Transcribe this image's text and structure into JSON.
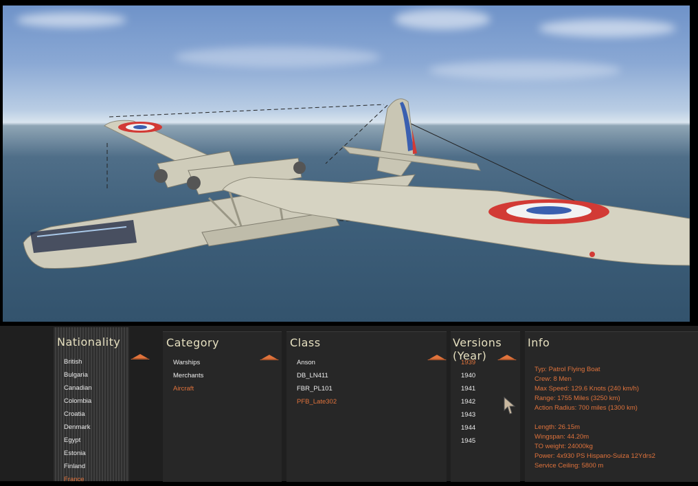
{
  "nationality": {
    "title": "Nationality",
    "items": [
      "British",
      "Bulgaria",
      "Canadian",
      "Colombia",
      "Croatia",
      "Denmark",
      "Egypt",
      "Estonia",
      "Finland",
      "France"
    ],
    "selected_index": 9
  },
  "category": {
    "title": "Category",
    "items": [
      "Warships",
      "Merchants",
      "Aircraft"
    ],
    "selected_index": 2
  },
  "class": {
    "title": "Class",
    "items": [
      "Anson",
      "DB_LN411",
      "FBR_PL101",
      "PFB_Late302"
    ],
    "selected_index": 3
  },
  "versions": {
    "title": "Versions (Year)",
    "items": [
      "1939",
      "1940",
      "1941",
      "1942",
      "1943",
      "1944",
      "1945"
    ],
    "selected_index": 0
  },
  "info": {
    "title": "Info",
    "lines_a": [
      "Typ: Patrol Flying Boat",
      "Crew: 8 Men",
      "Max Speed: 129.6 Knots (240 km/h)",
      "Range: 1755 Miles (3250 km)",
      "Action Radius: 700 miles (1300 km)"
    ],
    "lines_b": [
      "Length: 26.15m",
      "Wingspan: 44.20m",
      "TO weight: 24000kg",
      "Power: 4x930 PS Hispano-Suiza 12Ydrs2",
      "Service Ceiling: 5800 m"
    ]
  },
  "colors": {
    "accent": "#e0733c",
    "title": "#e6e0c0",
    "panel": "#272727",
    "roundel_red": "#d23a35",
    "roundel_blue": "#3a5fb0"
  },
  "icons": {
    "scroll_up": "scroll-up-icon",
    "cursor": "mouse-pointer-icon"
  }
}
